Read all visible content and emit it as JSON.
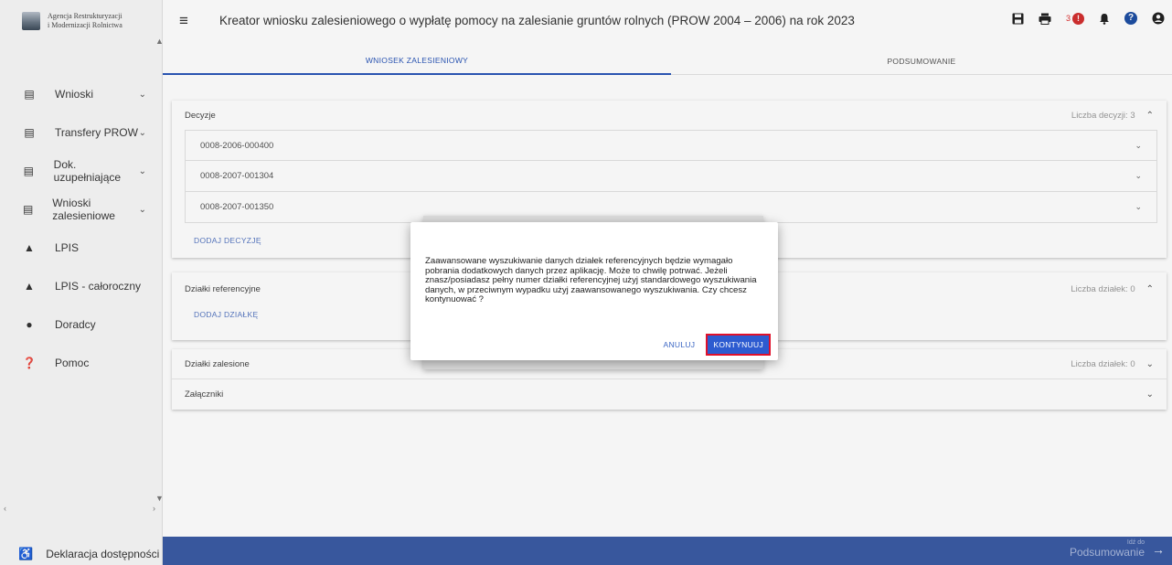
{
  "logo": {
    "line1": "Agencja Restrukturyzacji",
    "line2": "i Modernizacji Rolnictwa"
  },
  "sidebar": {
    "items": [
      {
        "icon": "clipboard-icon",
        "label": "Wnioski",
        "has_chevron": true
      },
      {
        "icon": "clipboard-icon",
        "label": "Transfery PROW",
        "has_chevron": true
      },
      {
        "icon": "clipboard-icon",
        "label": "Dok. uzupełniające",
        "has_chevron": true
      },
      {
        "icon": "clipboard-icon",
        "label": "Wnioski zalesieniowe",
        "has_chevron": true
      },
      {
        "icon": "terrain-icon",
        "label": "LPIS",
        "has_chevron": false
      },
      {
        "icon": "terrain-icon",
        "label": "LPIS - całoroczny",
        "has_chevron": false
      },
      {
        "icon": "person-icon",
        "label": "Doradcy",
        "has_chevron": false
      },
      {
        "icon": "help-circle-icon",
        "label": "Pomoc",
        "has_chevron": false
      }
    ],
    "footer_label": "Deklaracja dostępności"
  },
  "header": {
    "title": "Kreator wniosku zalesieniowego o wypłatę pomocy na zalesianie gruntów rolnych (PROW 2004 – 2006) na rok 2023",
    "notification_count": "3",
    "alert_glyph": "!",
    "help_glyph": "?"
  },
  "tabs": [
    {
      "label": "WNIOSEK ZALESIENIOWY",
      "active": true
    },
    {
      "label": "PODSUMOWANIE",
      "active": false
    }
  ],
  "decisions": {
    "title": "Decyzje",
    "count_label": "Liczba decyzji: 3",
    "rows": [
      "0008-2006-000400",
      "0008-2007-001304",
      "0008-2007-001350"
    ],
    "add_label": "DODAJ DECYZJĘ"
  },
  "reference_plots": {
    "title": "Działki referencyjne",
    "count_label": "Liczba działek: 0",
    "add_label": "DODAJ DZIAŁKĘ"
  },
  "afforested_plots": {
    "title": "Działki zalesione",
    "count_label": "Liczba działek: 0"
  },
  "attachments": {
    "title": "Załączniki"
  },
  "dialog": {
    "message": "Zaawansowane wyszukiwanie danych działek referencyjnych będzie wymagało pobrania dodatkowych danych przez aplikację. Może to chwilę potrwać. Jeżeli znasz/posiadasz pełny numer działki referencyjnej użyj standardowego wyszukiwania danych, w przeciwnym wypadku użyj zaawansowanego wyszukiwania. Czy chcesz kontynuować ?",
    "cancel_label": "ANULUJ",
    "continue_label": "KONTYNUUJ"
  },
  "footer": {
    "small": "Idź do",
    "big": "Podsumowanie"
  },
  "colors": {
    "accent": "#2b57b8",
    "footer_bar": "#3b5ba4",
    "highlight": "#e0102a"
  }
}
